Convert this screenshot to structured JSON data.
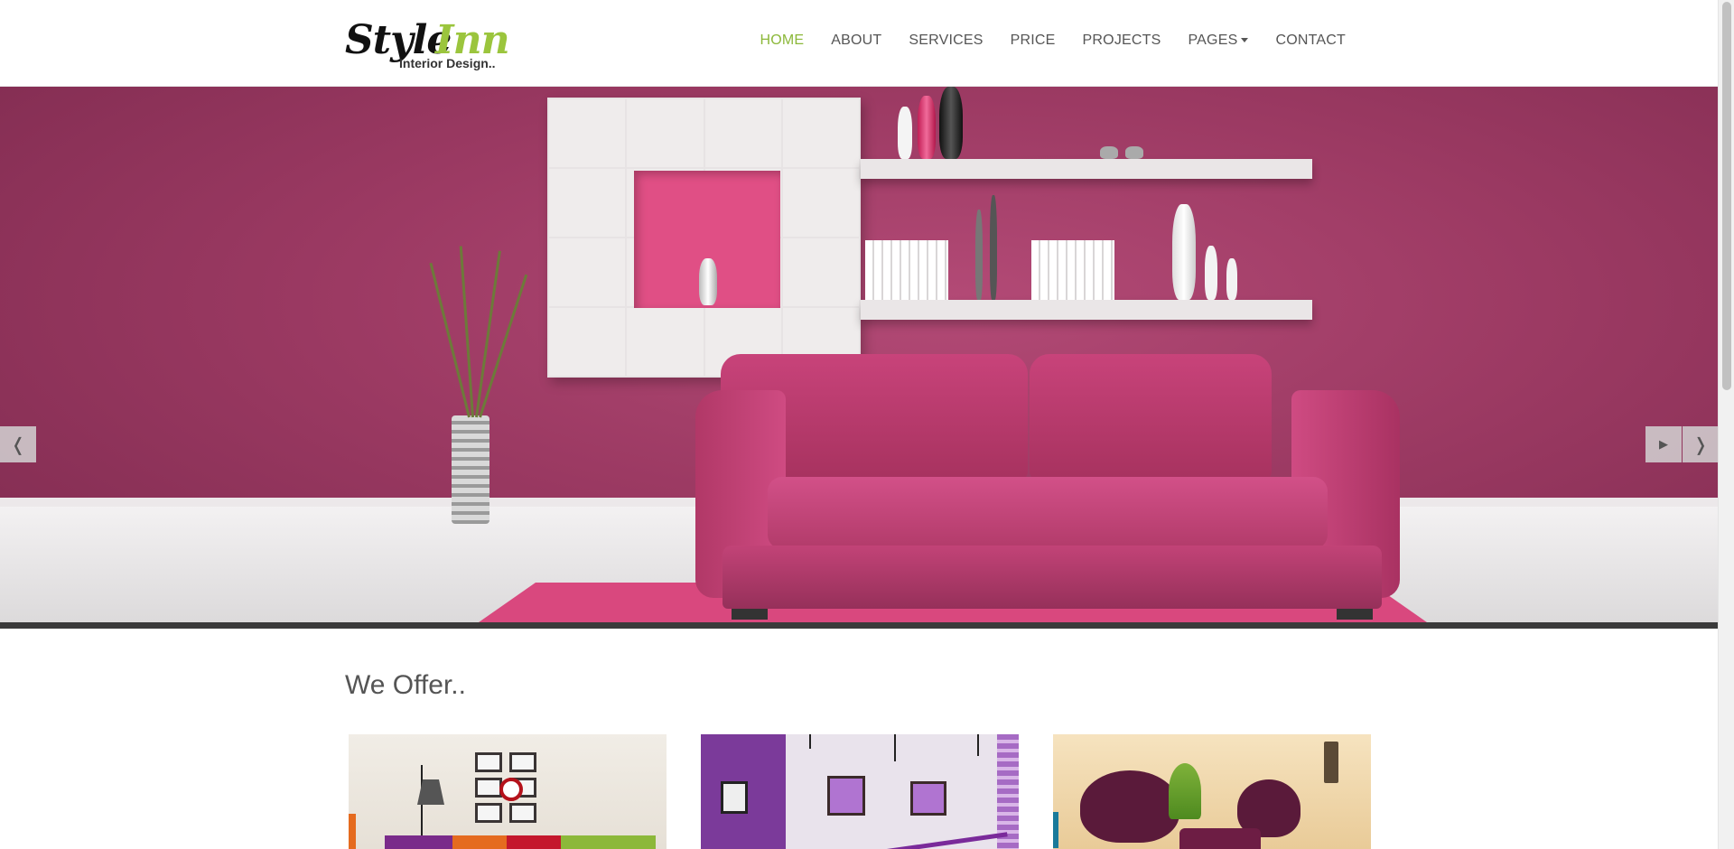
{
  "brand": {
    "logo_word_1": "Style",
    "logo_word_2": "Inn",
    "tagline": "Interior Design.."
  },
  "nav": {
    "items": [
      {
        "label": "HOME",
        "active": true
      },
      {
        "label": "ABOUT"
      },
      {
        "label": "SERVICES"
      },
      {
        "label": "PRICE"
      },
      {
        "label": "PROJECTS"
      },
      {
        "label": "PAGES",
        "dropdown": true
      },
      {
        "label": "CONTACT"
      }
    ]
  },
  "hero": {
    "prev_icon": "chevron-left-icon",
    "next_icon": "chevron-right-icon",
    "play_icon": "play-icon",
    "prev_glyph": "❬",
    "next_glyph": "❭",
    "play_glyph": "▶"
  },
  "offers": {
    "title": "We Offer.."
  },
  "colors": {
    "accent": "#8cb83a",
    "hero_wall": "#9c3a63",
    "sofa": "#c8437a"
  }
}
